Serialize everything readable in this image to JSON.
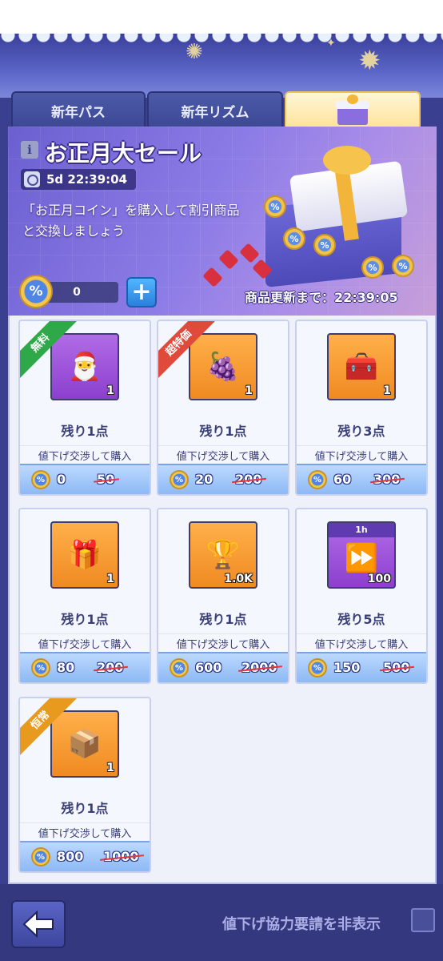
{
  "tabs": [
    {
      "label": "新年パス"
    },
    {
      "label": "新年リズム"
    },
    {
      "label": "",
      "icon": "gift-box-icon"
    }
  ],
  "hero": {
    "title": "お正月大セール",
    "timer": "5d 22:39:04",
    "description": "「お正月コイン」を購入して割引商品と交換しましょう",
    "refresh_label": "商品更新まで：22:39:05"
  },
  "currency": {
    "symbol": "%",
    "amount": "0",
    "add_label": "+"
  },
  "items": [
    {
      "ribbon": "無料",
      "ribbon_color": "#2fa84a",
      "image": "santa-gingerbread-icon",
      "bg": "purple",
      "qty": "1",
      "remaining": "残り1点",
      "action": "値下げ交渉して購入",
      "price": "0",
      "old_price": "50"
    },
    {
      "ribbon": "超特価",
      "ribbon_color": "#e04a3a",
      "image": "cornucopia-icon",
      "bg": "orange",
      "qty": "1",
      "remaining": "残り1点",
      "action": "値下げ交渉して購入",
      "price": "20",
      "old_price": "200"
    },
    {
      "ribbon": "",
      "image": "silver-chest-icon",
      "bg": "orange",
      "qty": "1",
      "remaining": "残り3点",
      "action": "値下げ交渉して購入",
      "price": "60",
      "old_price": "300"
    },
    {
      "ribbon": "",
      "image": "red-chest-tier2-icon",
      "bg": "orange",
      "qty": "1",
      "remaining": "残り1点",
      "action": "値下げ交渉して購入",
      "price": "80",
      "old_price": "200"
    },
    {
      "ribbon": "",
      "image": "trophy-icon",
      "bg": "orange",
      "qty": "1.0K",
      "remaining": "残り1点",
      "action": "値下げ交渉して購入",
      "price": "600",
      "old_price": "2000"
    },
    {
      "ribbon": "",
      "image": "fast-forward-icon",
      "bg": "purple",
      "img_label": "1h",
      "qty": "100",
      "remaining": "残り5点",
      "action": "値下げ交渉して購入",
      "price": "150",
      "old_price": "500"
    },
    {
      "ribbon": "恒常",
      "ribbon_color": "#e89a1e",
      "image": "gold-chest-tier2-icon",
      "bg": "orange",
      "qty": "1",
      "remaining": "残り1点",
      "action": "値下げ交渉して購入",
      "price": "800",
      "old_price": "1000"
    }
  ],
  "footer": {
    "hide_label": "値下げ協力要請を非表示"
  }
}
